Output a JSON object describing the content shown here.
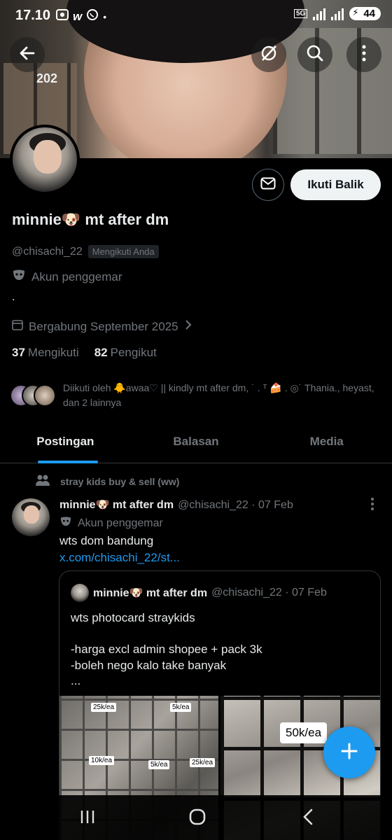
{
  "status_bar": {
    "time": "17.10",
    "network": "5G",
    "battery": "44"
  },
  "banner": {
    "text_fragment": "202"
  },
  "profile": {
    "display_name": "minnie🐶 mt after dm",
    "handle": "@chisachi_22",
    "follows_you": "Mengikuti Anda",
    "fan_label": "Akun penggemar",
    "bio": ".",
    "joined": "Bergabung September 2025",
    "following_count": "37",
    "following_label": "Mengikuti",
    "followers_count": "82",
    "followers_label": "Pengikut",
    "follow_button": "Ikuti Balik",
    "followed_by": "Diikuti oleh 🐥awaa♡ || kindly mt after dm, ˙ . ᵀ 🍰 . ◎˙ Thania., heyast, dan 2 lainnya"
  },
  "tabs": [
    {
      "label": "Postingan",
      "active": true
    },
    {
      "label": "Balasan",
      "active": false
    },
    {
      "label": "Media",
      "active": false
    }
  ],
  "post": {
    "community": "stray kids buy & sell (ww)",
    "author_name": "minnie🐶 mt after dm",
    "author_meta": "@chisachi_22 · 07 Feb",
    "fan_label": "Akun penggemar",
    "text": "wts dom bandung",
    "link": "x.com/chisachi_22/st...",
    "quote": {
      "author_name": "minnie🐶 mt after dm",
      "author_meta": "@chisachi_22 · 07 Feb",
      "body": "wts photocard straykids\n\n-harga excl admin shopee + pack 3k\n-boleh nego kalo take banyak\n...",
      "tags": [
        "25k/ea",
        "5k/ea",
        "10k/ea",
        "5k/ea",
        "25k/ea"
      ],
      "big_tag": "50k/ea"
    }
  },
  "colors": {
    "accent": "#1d9bf0",
    "background": "#000000",
    "secondary_text": "#71767b",
    "primary_text": "#e7e9ea"
  }
}
